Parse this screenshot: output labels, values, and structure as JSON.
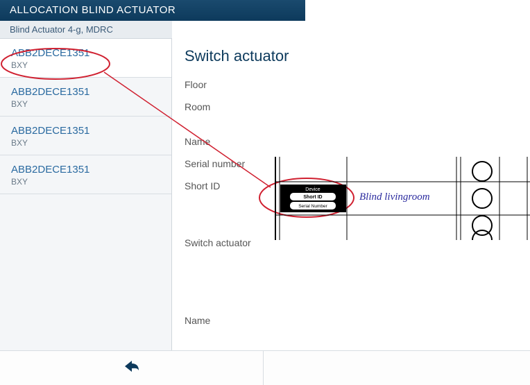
{
  "header": {
    "title": "ALLOCATION BLIND ACTUATOR"
  },
  "subheader": {
    "text": "Blind Actuator 4-g, MDRC"
  },
  "sidebar": {
    "items": [
      {
        "code": "ABB2DECE1351",
        "sub": "BXY"
      },
      {
        "code": "ABB2DECE1351",
        "sub": "BXY"
      },
      {
        "code": "ABB2DECE1351",
        "sub": "BXY"
      },
      {
        "code": "ABB2DECE1351",
        "sub": "BXY"
      }
    ]
  },
  "main": {
    "title": "Switch actuator",
    "fields": {
      "floor": "Floor",
      "room": "Room",
      "name": "Name",
      "serial": "Serial number",
      "shortid": "Short ID",
      "switch_actuator": "Switch actuator",
      "name2": "Name"
    }
  },
  "diagram": {
    "device_label": "Device",
    "shortid_label": "Short ID",
    "serial_label": "Serial Number",
    "handwriting": "Blind livingroom"
  }
}
